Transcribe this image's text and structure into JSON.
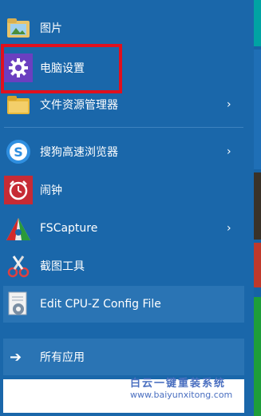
{
  "menu": {
    "pictures_label": "图片",
    "pc_settings_label": "电脑设置",
    "file_explorer_label": "文件资源管理器",
    "sogou_label": "搜狗高速浏览器",
    "alarm_label": "闹钟",
    "fscapture_label": "FSCapture",
    "snipping_label": "截图工具",
    "cpuz_label": "Edit CPU-Z Config File",
    "all_apps_label": "所有应用",
    "arrow_glyph": "›"
  },
  "watermark": {
    "line1": "白云一键重装系统",
    "line2": "www.baiyunxitong.com"
  },
  "colors": {
    "menu_bg": "#1a67aa",
    "highlight_border": "#e0101e",
    "tile_teal": "#00a3a3",
    "tile_red": "#c0392b",
    "tile_green": "#1e9e3a"
  }
}
